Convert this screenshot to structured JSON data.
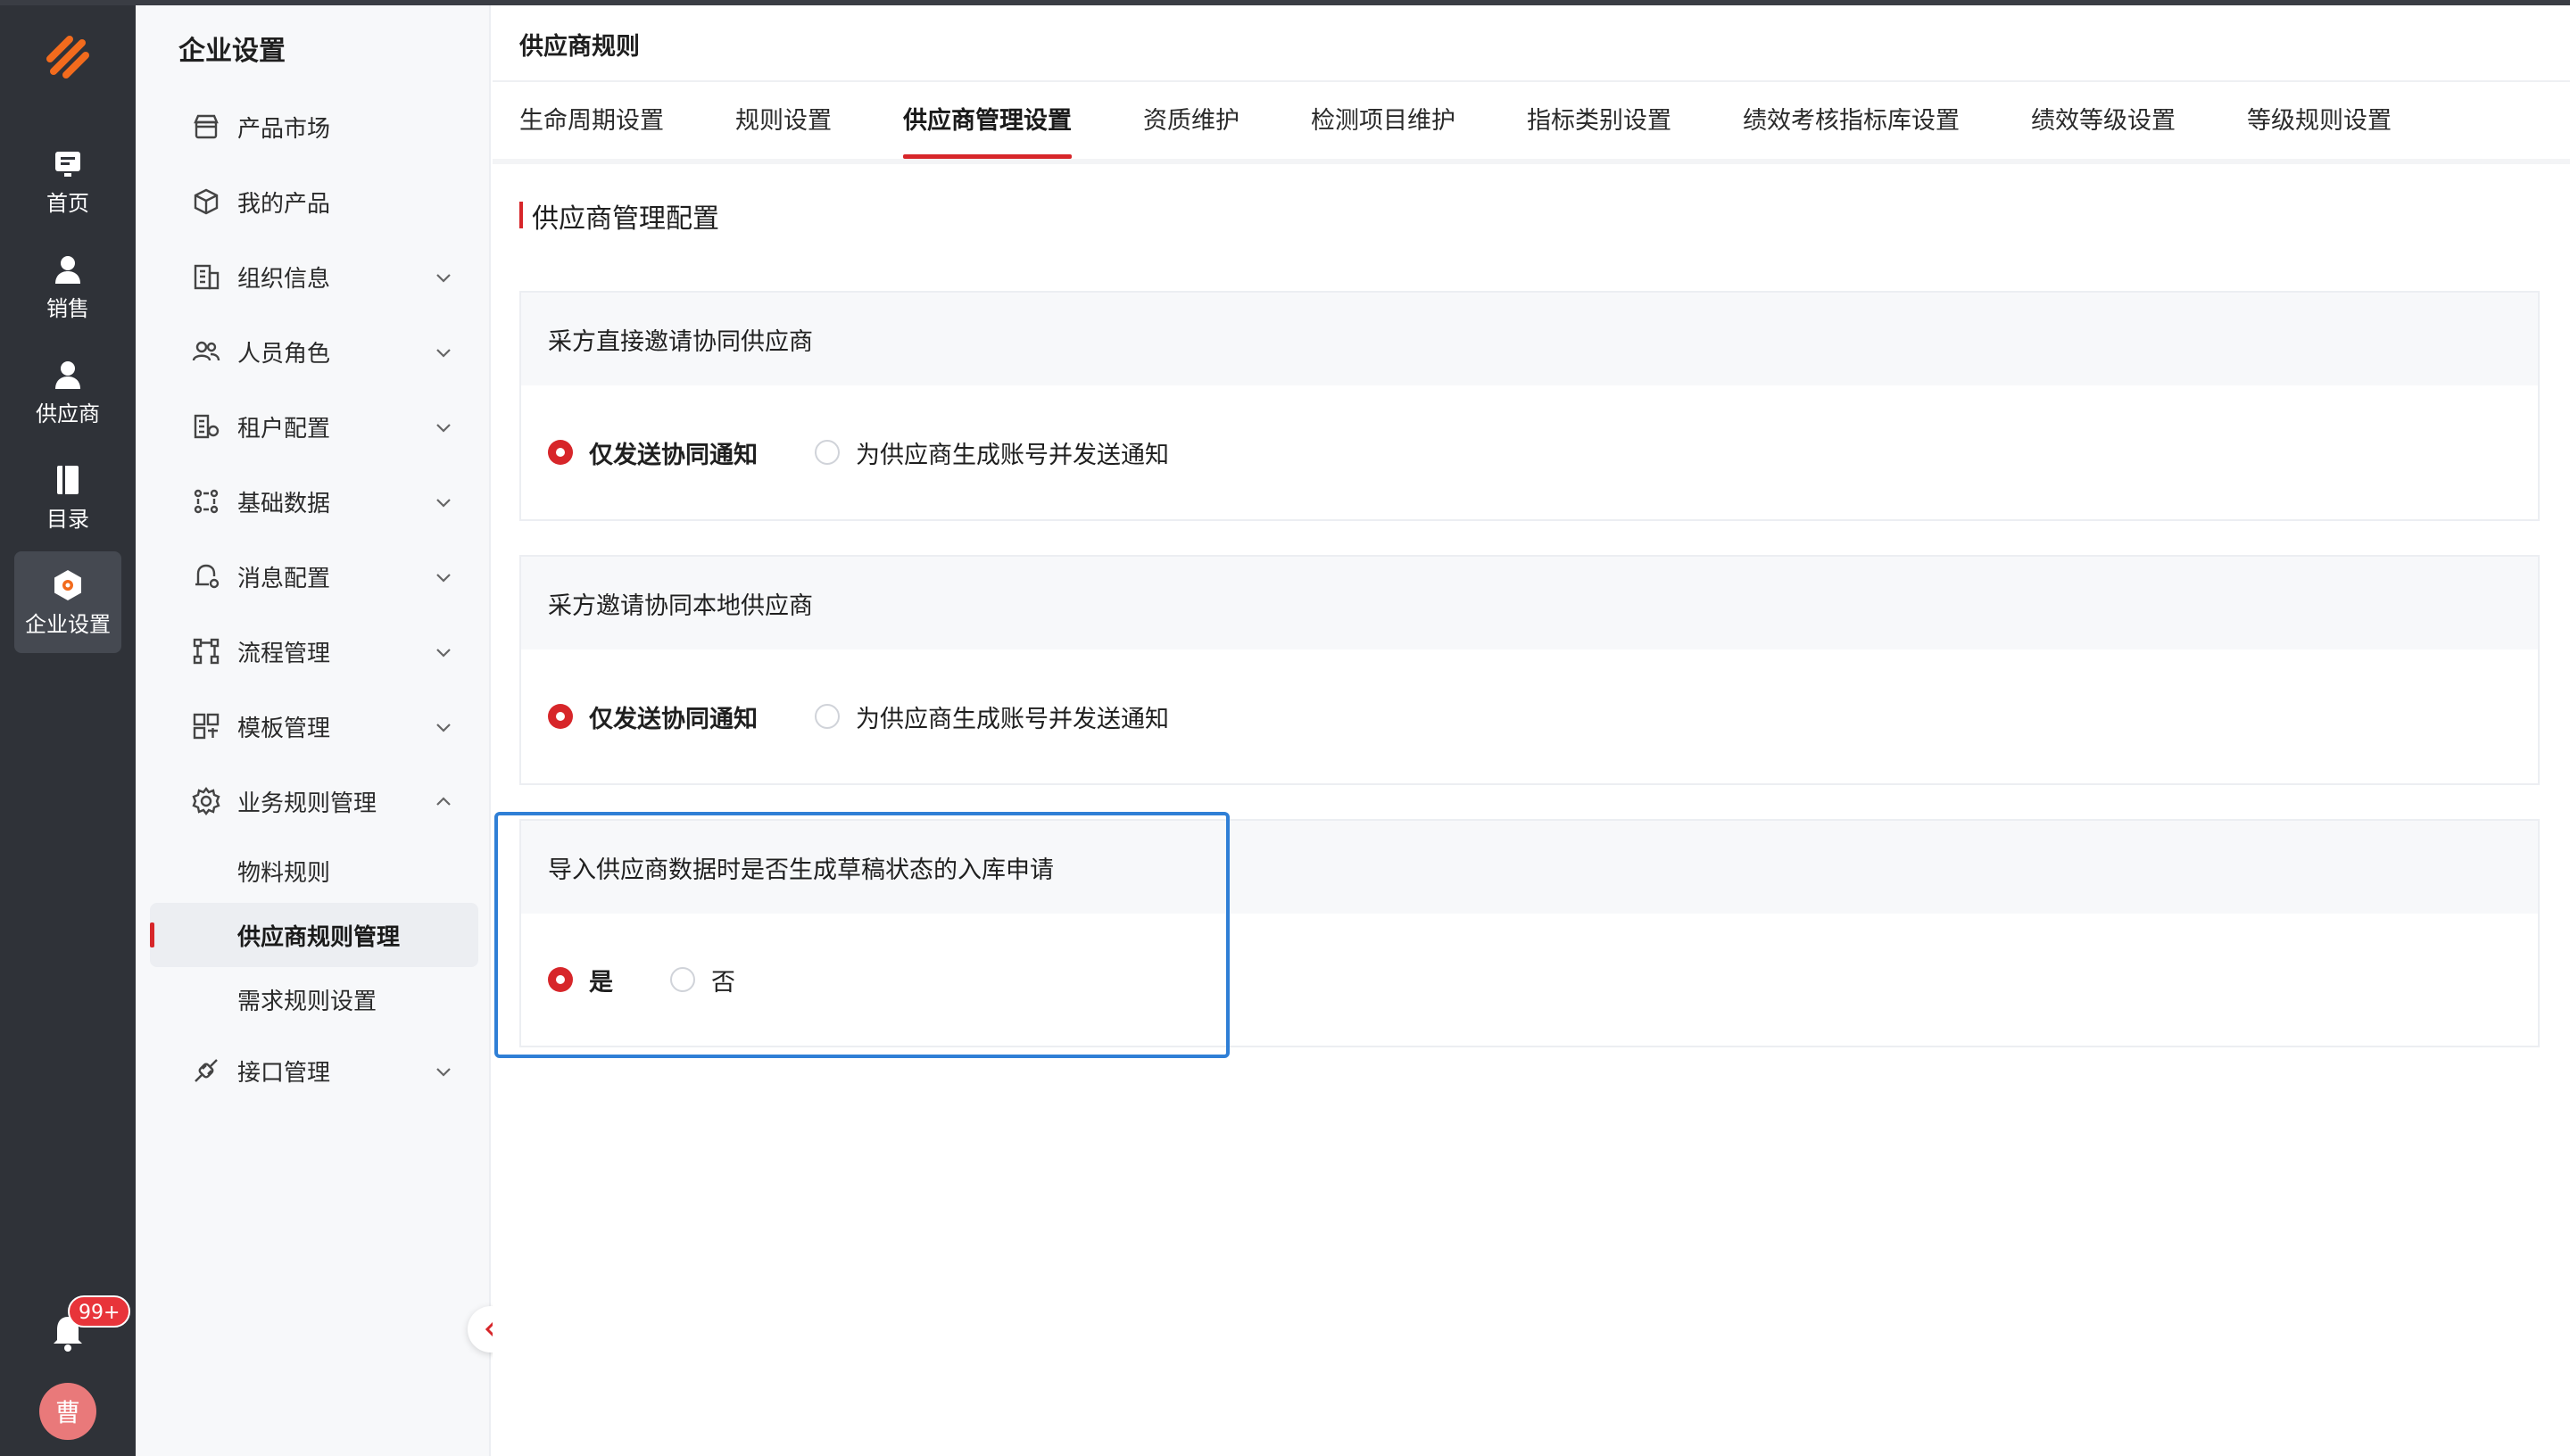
{
  "rail": {
    "items": [
      {
        "label": "首页",
        "icon": "monitor-icon"
      },
      {
        "label": "销售",
        "icon": "person-icon"
      },
      {
        "label": "供应商",
        "icon": "person-icon"
      },
      {
        "label": "目录",
        "icon": "book-icon"
      },
      {
        "label": "企业设置",
        "icon": "settings-hex-icon"
      }
    ],
    "badge": "99+",
    "avatar": "曹"
  },
  "sidebar": {
    "title": "企业设置",
    "items": [
      {
        "label": "产品市场",
        "icon": "store-icon"
      },
      {
        "label": "我的产品",
        "icon": "cube-icon"
      },
      {
        "label": "组织信息",
        "icon": "building-icon"
      },
      {
        "label": "人员角色",
        "icon": "users-icon"
      },
      {
        "label": "租户配置",
        "icon": "tenant-icon"
      },
      {
        "label": "基础数据",
        "icon": "grid-dots-icon"
      },
      {
        "label": "消息配置",
        "icon": "message-icon"
      },
      {
        "label": "流程管理",
        "icon": "flow-icon"
      },
      {
        "label": "模板管理",
        "icon": "template-icon"
      },
      {
        "label": "业务规则管理",
        "icon": "gear-icon"
      },
      {
        "label": "接口管理",
        "icon": "plug-icon"
      }
    ],
    "subitems": [
      {
        "label": "物料规则"
      },
      {
        "label": "供应商规则管理"
      },
      {
        "label": "需求规则设置"
      }
    ]
  },
  "main": {
    "page_title": "供应商规则",
    "tabs": [
      {
        "label": "生命周期设置"
      },
      {
        "label": "规则设置"
      },
      {
        "label": "供应商管理设置"
      },
      {
        "label": "资质维护"
      },
      {
        "label": "检测项目维护"
      },
      {
        "label": "指标类别设置"
      },
      {
        "label": "绩效考核指标库设置"
      },
      {
        "label": "绩效等级设置"
      },
      {
        "label": "等级规则设置"
      }
    ],
    "section_title": "供应商管理配置",
    "cards": [
      {
        "title": "采方直接邀请协同供应商",
        "options": [
          {
            "label": "仅发送协同通知",
            "checked": true
          },
          {
            "label": "为供应商生成账号并发送通知",
            "checked": false
          }
        ]
      },
      {
        "title": "采方邀请协同本地供应商",
        "options": [
          {
            "label": "仅发送协同通知",
            "checked": true
          },
          {
            "label": "为供应商生成账号并发送通知",
            "checked": false
          }
        ]
      },
      {
        "title": "导入供应商数据时是否生成草稿状态的入库申请",
        "options": [
          {
            "label": "是",
            "checked": true
          },
          {
            "label": "否",
            "checked": false
          }
        ]
      }
    ]
  },
  "colors": {
    "accent": "#d7262a",
    "rail_bg": "#2f3238",
    "highlight": "#2f7fd6"
  }
}
